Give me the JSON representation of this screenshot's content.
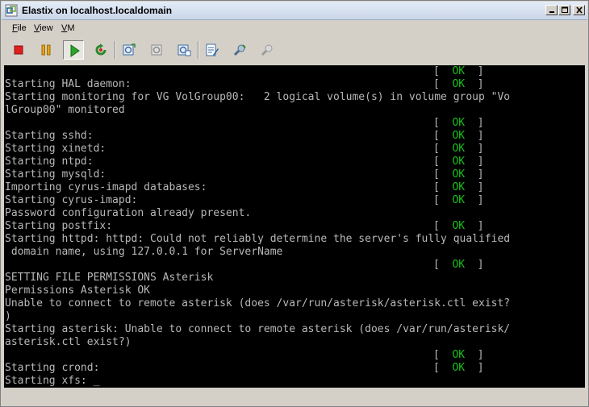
{
  "window": {
    "title": "Elastix on localhost.localdomain"
  },
  "menu": [
    {
      "label": "File",
      "mnemonic": "F",
      "rest": "ile"
    },
    {
      "label": "View",
      "mnemonic": "V",
      "rest": "iew"
    },
    {
      "label": "VM",
      "mnemonic": "V",
      "rest": "M"
    }
  ],
  "toolbar": {
    "icons": [
      "stop-icon",
      "pause-icon",
      "play-icon",
      "reset-icon",
      "snapshot-icon",
      "revert-snapshot-icon",
      "manage-snapshots-icon",
      "settings-icon",
      "connect-icon",
      "disconnect-icon"
    ],
    "colors": {
      "stop": "#e0201c",
      "pause": "#e8a318",
      "play": "#2aa52a",
      "reset": "#2a8a2a"
    }
  },
  "console": {
    "colors": {
      "background": "#000000",
      "text": "#b8b8b8",
      "ok": "#19c019"
    },
    "ok_open": "[  ",
    "ok_word": "OK",
    "ok_close": "  ]",
    "lines": [
      {
        "text": "",
        "ok": true
      },
      {
        "text": "Starting HAL daemon:",
        "ok": true
      },
      {
        "text": "Starting monitoring for VG VolGroup00:   2 logical volume(s) in volume group \"Vo",
        "ok": false
      },
      {
        "text": "lGroup00\" monitored",
        "ok": false
      },
      {
        "text": "",
        "ok": true
      },
      {
        "text": "Starting sshd:",
        "ok": true
      },
      {
        "text": "Starting xinetd:",
        "ok": true
      },
      {
        "text": "Starting ntpd:",
        "ok": true
      },
      {
        "text": "Starting mysqld:",
        "ok": true
      },
      {
        "text": "Importing cyrus-imapd databases:",
        "ok": true
      },
      {
        "text": "Starting cyrus-imapd:",
        "ok": true
      },
      {
        "text": "Password configuration already present.",
        "ok": false
      },
      {
        "text": "Starting postfix:",
        "ok": true
      },
      {
        "text": "Starting httpd: httpd: Could not reliably determine the server's fully qualified",
        "ok": false
      },
      {
        "text": " domain name, using 127.0.0.1 for ServerName",
        "ok": false
      },
      {
        "text": "",
        "ok": true
      },
      {
        "text": "SETTING FILE PERMISSIONS Asterisk",
        "ok": false
      },
      {
        "text": "Permissions Asterisk OK",
        "ok": false
      },
      {
        "text": "Unable to connect to remote asterisk (does /var/run/asterisk/asterisk.ctl exist?",
        "ok": false
      },
      {
        "text": ")",
        "ok": false
      },
      {
        "text": "Starting asterisk: Unable to connect to remote asterisk (does /var/run/asterisk/",
        "ok": false
      },
      {
        "text": "asterisk.ctl exist?)",
        "ok": false
      },
      {
        "text": "",
        "ok": true
      },
      {
        "text": "Starting crond:",
        "ok": true
      },
      {
        "text": "Starting xfs: _",
        "ok": false
      }
    ]
  }
}
